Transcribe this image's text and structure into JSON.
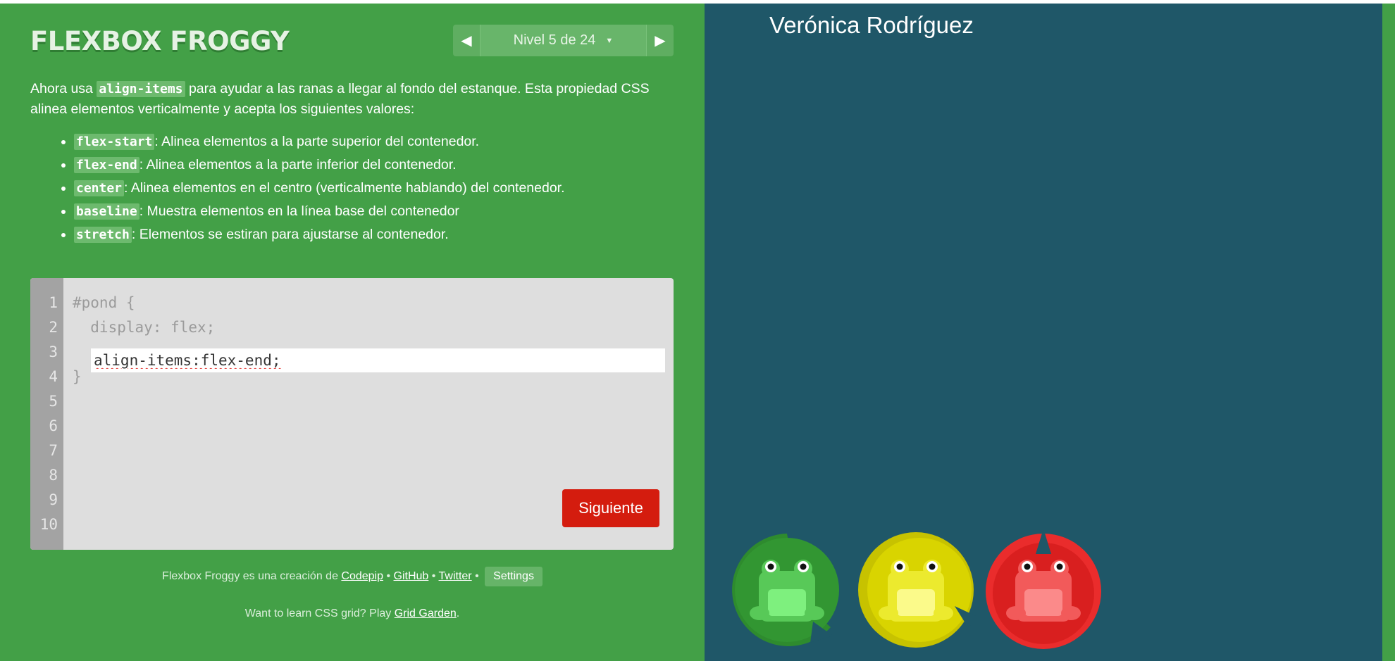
{
  "app": {
    "logo": "FLEXBOX FROGGY",
    "level": "Nivel 5 de 24",
    "prev_icon": "triangle-left-icon",
    "next_icon": "triangle-right-icon",
    "dropdown_icon": "dropdown-caret-icon"
  },
  "instructions": {
    "intro_before": "Ahora usa ",
    "intro_code": "align-items",
    "intro_after": " para ayudar a las ranas a llegar al fondo del estanque. Esta propiedad CSS alinea elementos verticalmente y acepta los siguientes valores:",
    "values": [
      {
        "code": "flex-start",
        "text": ": Alinea elementos a la parte superior del contenedor."
      },
      {
        "code": "flex-end",
        "text": ": Alinea elementos a la parte inferior del contenedor."
      },
      {
        "code": "center",
        "text": ": Alinea elementos en el centro (verticalmente hablando) del contenedor."
      },
      {
        "code": "baseline",
        "text": ": Muestra elementos en la línea base del contenedor"
      },
      {
        "code": "stretch",
        "text": ": Elementos se estiran para ajustarse al contenedor."
      }
    ]
  },
  "editor": {
    "line_numbers": [
      "1",
      "2",
      "3",
      "4",
      "5",
      "6",
      "7",
      "8",
      "9",
      "10"
    ],
    "line1": "#pond {",
    "line2": "  display: flex;",
    "input_value": "align-items:flex-end;",
    "line4": "}",
    "next_label": "Siguiente"
  },
  "footer": {
    "credits_prefix": "Flexbox Froggy es una creación de ",
    "codepip": "Codepip",
    "sep": " • ",
    "github": "GitHub",
    "twitter": "Twitter",
    "settings": "Settings",
    "grid_prefix": "Want to learn CSS grid? Play ",
    "grid_link": "Grid Garden",
    "grid_suffix": "."
  },
  "pond": {
    "author": "Verónica Rodríguez",
    "frogs": [
      "green",
      "yellow",
      "red"
    ]
  },
  "colors": {
    "sidebar": "#43a047",
    "pond": "#1f5768",
    "button": "#d41c0e",
    "frog_green": "#2e8b2e",
    "frog_yellow": "#d9d400",
    "frog_red": "#d91f1f"
  }
}
